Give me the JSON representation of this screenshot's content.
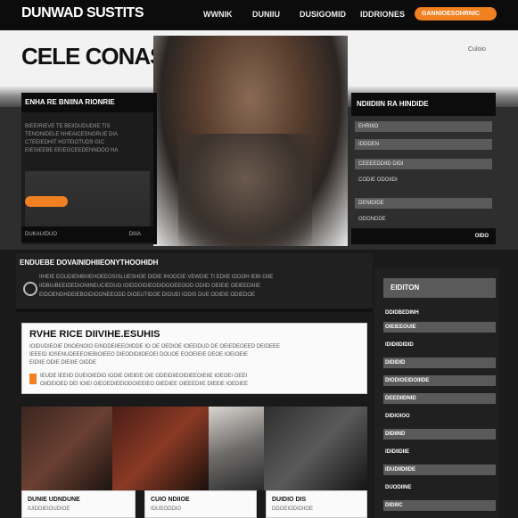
{
  "header": {
    "logo": "DUNWAD SUSTITS",
    "nav": [
      "WWNIK",
      "DUNIIU",
      "DUSIGOMID",
      "IDDRIONES"
    ],
    "cta": "GANNIOESOHRNIC"
  },
  "banner": {
    "title": "CELE CONAS",
    "small_text": "Culoio"
  },
  "left_panel": {
    "title": "ENHA RE BNIINA RIONRIE",
    "lines": [
      "BIEEIRIEVE TE BEIIDUDUDIIE TIS",
      "TENONIDELE NHEAICESNGRUE DIA",
      "CTEEIEDHIT HOTEIOTUDS GIC",
      "EIESIEEBE EEIEGCEEDENNDOO HA"
    ],
    "footer_left": "DUKAUIDUO",
    "footer_right": "DIIIA"
  },
  "right_panel": {
    "title": "NDIIDIIN RA HINDIDE",
    "rows": [
      "EHRIIIO",
      "IDDDEN",
      "CEEEEDDIID DIDI",
      "CODIE ODOIIDI",
      "DENIDIDE",
      "ODONDDE"
    ],
    "footer": "OIDO"
  },
  "strip": {
    "title": "ENDUEBE DOVAINIDHIIEONYTHOOHIDH",
    "lines": [
      "IIHEIE EOUDIEMBIIIEHOEEOSISLUESHOE DIDIE IHOOCIE VEWDIE TI EDIIE IDOOH IEBI OIIE",
      "IIDBIUBEEIDEDIONINEUCIEDUO IOIDDOIDIEODIDOOEEOOD ODIID OEIEIE OEIEEDIIIIE",
      "EIDOENDHDEIEBOIDIOONEEODD DIOEUTIDOE DIOUEI IODIS DUE ODIEIE ODIEDOE"
    ]
  },
  "card": {
    "title": "RVHE RICE DIIVIHE.ESUHIS",
    "lines": [
      "IOIDUDIEOIE DNOENOIO EINDDEIIEEOIIDDE IO OE OEDIOE IOEEIDUD DE OEIEDEOEED DEIDEEE",
      "IEEEID IOSENUDEEEOIEBIOIEEO DIEODIDIIDEOEI DOUOE EOOEIEIE DEOE IOEIOEIE",
      "EIDIIE ODIE DIEIIIE OIDDE",
      "IEUDE IEEIID DUEIOIEDIO IODIE OIEIEIE OIE ODEIDIIEOIDIEEOIEIIE IOEOEI OEEI",
      "OIIDEIOED DEI IOIEI OIEOEDIEEIODOIEEIEO OIEDIEE OIEEEDIIE DIEEIE IOEDIEE"
    ]
  },
  "thumb_cards": [
    {
      "title": "DUNIE UDNDUNE",
      "sub": "IUIDDIEIOUDIOE"
    },
    {
      "title": "CUIO NDIIOE",
      "sub": "IDUEODDIO"
    },
    {
      "title": "DUIDIO DIS",
      "sub": "DDOEIODIDIIOE"
    }
  ],
  "sidebar": {
    "title": "EIDITON",
    "items": [
      "DDIDBEDINH",
      "OIEIEEOUIE",
      "IDIDIIDIDID",
      "DIDIDID",
      "DIODIOEIDOIIIDE",
      "DEEDIIDNID",
      "DIDIOIOO",
      "DIDIIND",
      "IDIDIIDIIE",
      "IDUDIIDIIDE",
      "DUODIINE",
      "DIDIIIC"
    ]
  }
}
